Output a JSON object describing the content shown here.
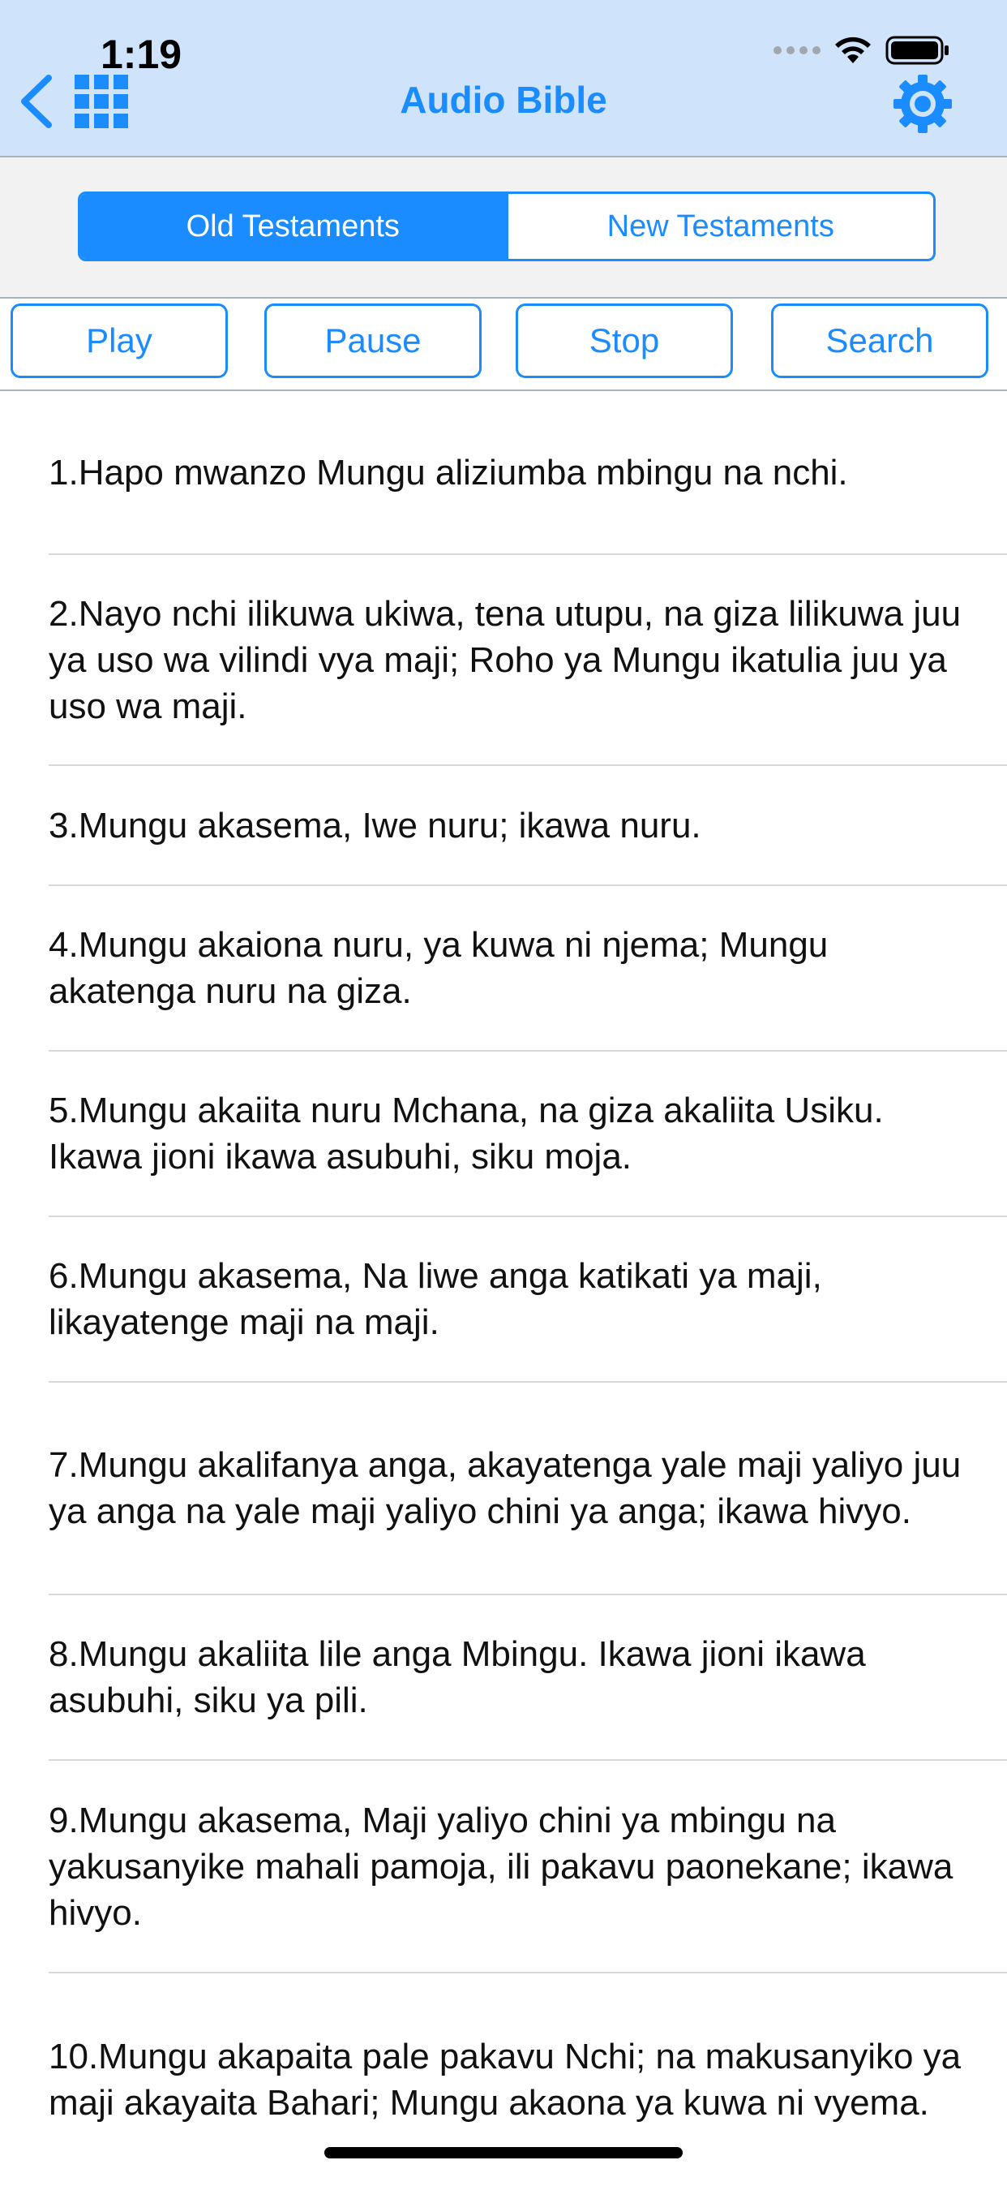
{
  "status": {
    "time": "1:19"
  },
  "nav": {
    "title": "Audio Bible",
    "back_icon": "back-chevron-icon",
    "grid_icon": "grid-menu-icon",
    "settings_icon": "gear-icon"
  },
  "segments": {
    "old": "Old Testaments",
    "new": "New Testaments",
    "selected": "old"
  },
  "controls": {
    "play": "Play",
    "pause": "Pause",
    "stop": "Stop",
    "search": "Search"
  },
  "verses": [
    "1.Hapo mwanzo Mungu aliziumba mbingu na nchi.",
    "2.Nayo nchi ilikuwa ukiwa, tena utupu, na giza lilikuwa juu ya uso wa vilindi vya maji; Roho ya Mungu ikatulia juu ya uso wa maji.",
    "3.Mungu akasema, Iwe nuru; ikawa nuru.",
    "4.Mungu akaiona nuru, ya kuwa ni njema; Mungu akatenga nuru na giza.",
    "5.Mungu akaiita nuru Mchana, na giza akaliita Usiku. Ikawa jioni ikawa asubuhi, siku moja.",
    "6.Mungu akasema, Na liwe anga katikati ya maji, likayatenge maji na maji.",
    "7.Mungu akalifanya anga, akayatenga yale maji yaliyo juu ya anga na yale maji yaliyo chini ya anga; ikawa hivyo.",
    "8.Mungu akaliita lile anga Mbingu. Ikawa jioni ikawa asubuhi, siku ya pili.",
    "9.Mungu akasema, Maji yaliyo chini ya mbingu na yakusanyike mahali pamoja, ili pakavu paonekane; ikawa hivyo.",
    "10.Mungu akapaita pale pakavu Nchi; na makusanyiko ya maji akayaita Bahari; Mungu akaona ya kuwa ni vyema."
  ],
  "colors": {
    "accent": "#1a8cff",
    "nav_bg": "#cfe3fb",
    "segment_bg": "#f2f2f2"
  }
}
